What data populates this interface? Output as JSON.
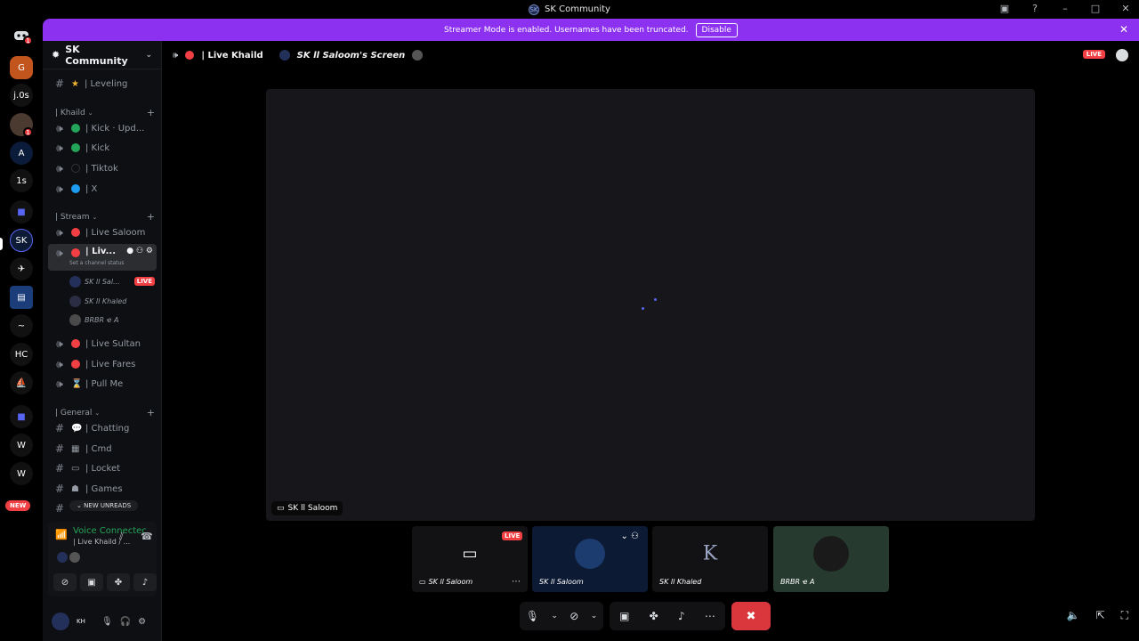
{
  "window": {
    "title": "SK Community",
    "logo": "SK"
  },
  "banner": {
    "text": "Streamer Mode is enabled. Usernames have been truncated.",
    "button": "Disable"
  },
  "rail": {
    "servers": [
      "j.0s",
      "1s",
      "HC"
    ],
    "new_label": "NEW",
    "badge_count": "1"
  },
  "sidebar": {
    "guild_name": "SK Community",
    "channels_top": [
      {
        "name": "| Leveling"
      }
    ],
    "categories": {
      "khaild": "| Khaild",
      "stream": "| Stream",
      "general": "| General"
    },
    "khaild_channels": [
      {
        "name": "| Kick · Upd...",
        "color": "#23a559"
      },
      {
        "name": "| Kick",
        "color": "#23a559"
      },
      {
        "name": "| Tiktok",
        "color": "#0e0f12"
      },
      {
        "name": "| X",
        "color": "#1d9bf0"
      }
    ],
    "stream_channels": [
      {
        "name": "| Live Saloom"
      },
      {
        "name": "| Liv...",
        "status": "Set a channel status"
      }
    ],
    "voice_users": [
      {
        "name": "SK ll Sal...",
        "live": "LIVE"
      },
      {
        "name": "SK ll Khaled"
      },
      {
        "name": "BRBR ҽ A"
      }
    ],
    "stream_channels_2": [
      {
        "name": "| Live Sultan"
      },
      {
        "name": "| Live Fares"
      },
      {
        "name": "| Pull Me"
      }
    ],
    "general_channels": [
      {
        "name": "| Chatting"
      },
      {
        "name": "| Cmd"
      },
      {
        "name": "| Locket"
      },
      {
        "name": "| Games"
      }
    ],
    "new_unreads": "NEW UNREADS",
    "voice_panel": {
      "title": "Voice Connectec",
      "sub": "| Live Khaild / ..."
    },
    "user": {
      "initials": "KH"
    }
  },
  "stage": {
    "channel": "| Live Khaild",
    "screen_title": "SK ll Saloom's Screen",
    "live": "LIVE",
    "stream_tag": "SK ll Saloom",
    "tiles": [
      {
        "name": "SK ll Saloom",
        "live": "LIVE"
      },
      {
        "name": "SK ll Saloom"
      },
      {
        "name": "SK ll Khaled"
      },
      {
        "name": "BRBR ҽ A"
      }
    ]
  },
  "colors": {
    "accent": "#5865f2",
    "live": "#f23f43",
    "banner": "#8c31f0",
    "hangup": "#da373c",
    "online": "#23a559"
  }
}
